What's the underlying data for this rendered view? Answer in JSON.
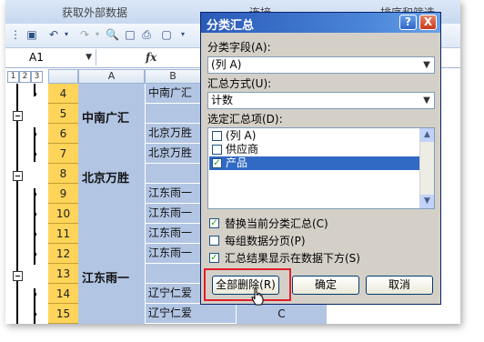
{
  "ribbon": {
    "groups": [
      "获取外部数据",
      "连接",
      "排序和筛选"
    ]
  },
  "formula_bar": {
    "name_box": "A1",
    "fx": "fx"
  },
  "outline_levels": [
    "1",
    "2",
    "3"
  ],
  "columns": [
    "A",
    "B"
  ],
  "rows": [
    {
      "num": "4",
      "a": "",
      "b": "中南广汇",
      "c": ""
    },
    {
      "num": "5",
      "a": "中南广汇",
      "b": "",
      "c": ""
    },
    {
      "num": "6",
      "a": "",
      "b": "北京万胜",
      "c": ""
    },
    {
      "num": "7",
      "a": "",
      "b": "北京万胜",
      "c": ""
    },
    {
      "num": "8",
      "a": "北京万胜",
      "b": "",
      "c": ""
    },
    {
      "num": "9",
      "a": "",
      "b": "江东雨一",
      "c": ""
    },
    {
      "num": "10",
      "a": "",
      "b": "江东雨一",
      "c": ""
    },
    {
      "num": "11",
      "a": "",
      "b": "江东雨一",
      "c": ""
    },
    {
      "num": "12",
      "a": "",
      "b": "江东雨一",
      "c": ""
    },
    {
      "num": "13",
      "a": "江东雨一",
      "b": "",
      "c": ""
    },
    {
      "num": "14",
      "a": "",
      "b": "辽宁仁爱",
      "c": ""
    },
    {
      "num": "15",
      "a": "",
      "b": "辽宁仁爱",
      "c": "C"
    }
  ],
  "dialog": {
    "title": "分类汇总",
    "help_glyph": "?",
    "close_glyph": "X",
    "group_field_label": "分类字段(A):",
    "group_field_value": "(列 A)",
    "function_label": "汇总方式(U):",
    "function_value": "计数",
    "items_label": "选定汇总项(D):",
    "items": [
      {
        "label": "(列 A)",
        "checked": false,
        "selected": false
      },
      {
        "label": "供应商",
        "checked": false,
        "selected": false
      },
      {
        "label": "产品",
        "checked": true,
        "selected": true
      }
    ],
    "options": [
      {
        "label": "替换当前分类汇总(C)",
        "checked": true
      },
      {
        "label": "每组数据分页(P)",
        "checked": false
      },
      {
        "label": "汇总结果显示在数据下方(S)",
        "checked": true
      }
    ],
    "buttons": {
      "remove_all": "全部删除(R)",
      "ok": "确定",
      "cancel": "取消"
    }
  },
  "colors": {
    "row_header": "#ffd45a",
    "cell_fill": "#b2c5e3",
    "highlight": "#e0202a",
    "title_bar": "#2a5ab8"
  }
}
